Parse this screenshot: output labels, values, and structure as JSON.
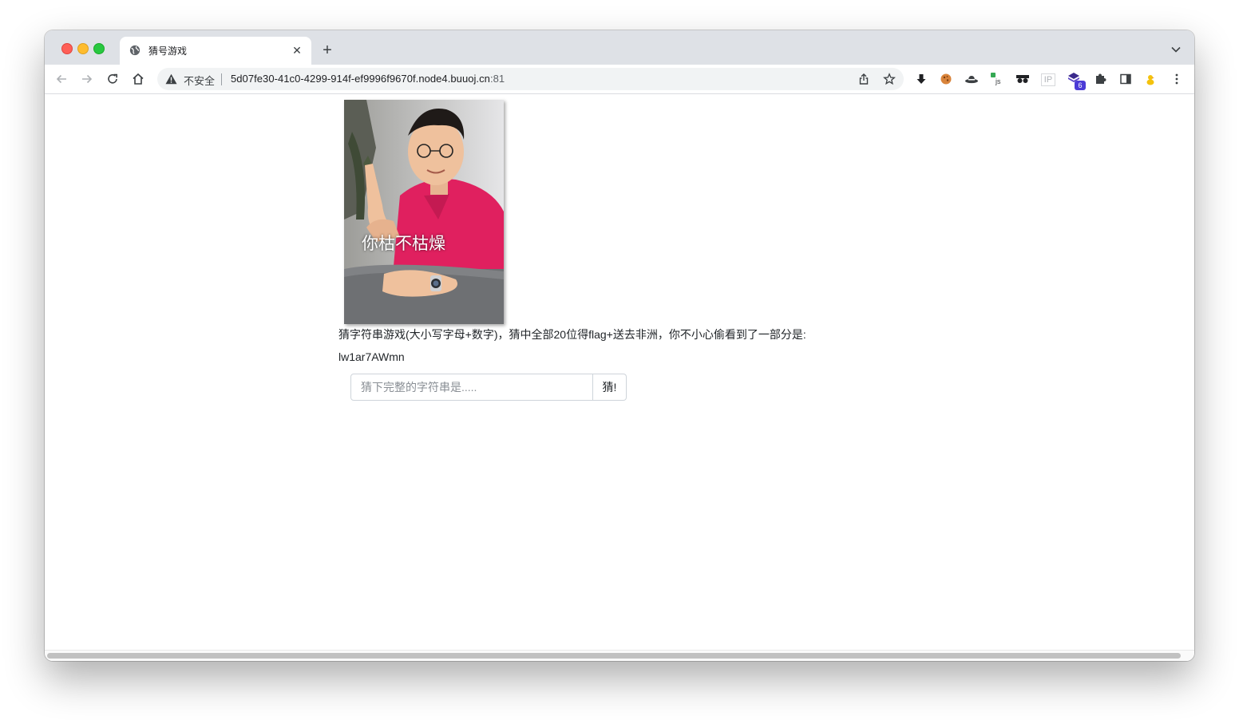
{
  "browser": {
    "tab_title": "猜号游戏",
    "security_label": "不安全",
    "url_host": "5d07fe30-41c0-4299-914f-ef9996f9670f.node4.buuoj.cn",
    "url_port": ":81",
    "extension_badge": "6",
    "ip_extension_label": "IP"
  },
  "page": {
    "image_caption": "你枯不枯燥",
    "description": "猜字符串游戏(大小写字母+数字)，猜中全部20位得flag+送去非洲，你不小心偷看到了一部分是:",
    "partial_string": "lw1ar7AWmn",
    "input_placeholder": "猜下完整的字符串是.....",
    "input_value": "",
    "submit_label": "猜!"
  },
  "colors": {
    "tabbar_bg": "#dee1e6",
    "omnibox_bg": "#f1f3f4",
    "meme_shirt": "#e0205f"
  }
}
